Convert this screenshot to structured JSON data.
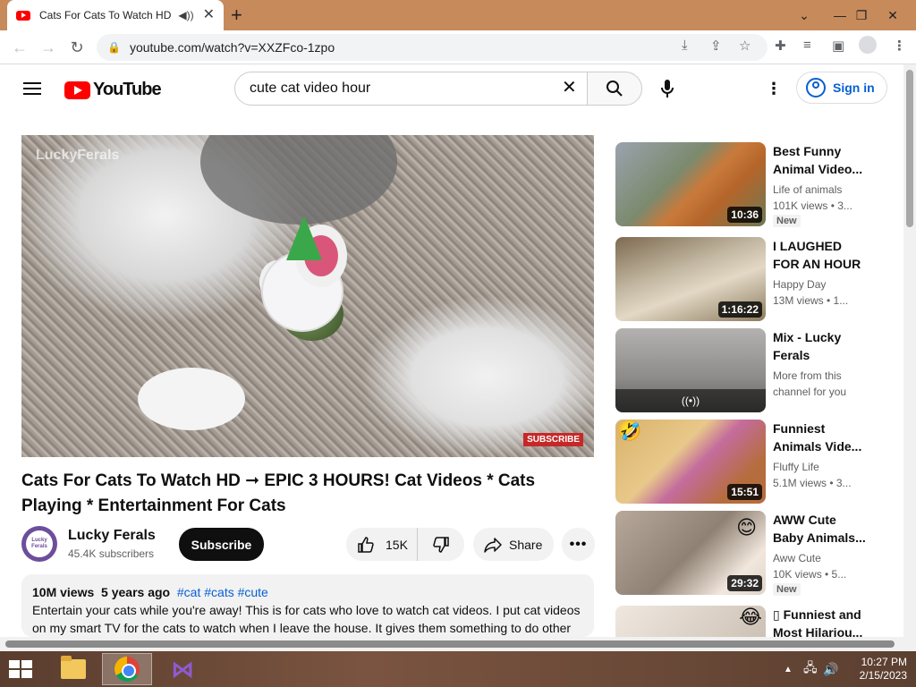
{
  "browser": {
    "tab_title": "Cats For Cats To Watch HD -",
    "new_tab": "+",
    "url": "youtube.com/watch?v=XXZFco-1zpo",
    "window_controls": {
      "dropdown": "⌄",
      "minimize": "—",
      "restore": "❐",
      "close": "✕"
    }
  },
  "header": {
    "logo_text": "YouTube",
    "search_query": "cute cat video hour",
    "signin_label": "Sign in"
  },
  "player": {
    "watermark": "LuckyFerals",
    "subscribe_badge": "SUBSCRIBE"
  },
  "video": {
    "title": "Cats For Cats To Watch HD ➞ EPIC 3 HOURS! Cat Videos * Cats Playing * Entertainment For Cats",
    "channel_name": "Lucky Ferals",
    "channel_avatar_text": "Lucky Ferals",
    "subscribers": "45.4K subscribers",
    "subscribe_label": "Subscribe",
    "likes": "15K",
    "share_label": "Share",
    "more_label": "•••",
    "views": "10M views",
    "age": "5 years ago",
    "hashtags": "#cat #cats #cute",
    "description": "Entertain your cats while you're away! This is for cats who love to watch cat videos. I put cat videos on my smart TV for the cats to watch when I leave the house. It gives them something to do other"
  },
  "recommendations": [
    {
      "title": "Best Funny Animal Video...",
      "channel": "Life of animals",
      "views": "101K views  • 3...",
      "duration": "10:36",
      "badge": "New"
    },
    {
      "title": "I LAUGHED FOR AN HOUR😹...",
      "channel": "Happy Day",
      "views": "13M views  • 1...",
      "duration": "1:16:22",
      "badge": ""
    },
    {
      "title": "Mix - Lucky Ferals",
      "channel": "More from this channel for you",
      "views": "",
      "duration": "",
      "mix_icon": "((•))",
      "badge": ""
    },
    {
      "title": "Funniest Animals Vide...",
      "channel": "Fluffy Life",
      "views": "5.1M views  • 3...",
      "duration": "15:51",
      "badge": ""
    },
    {
      "title": "AWW Cute Baby Animals...",
      "channel": "Aww Cute",
      "views": "10K views  • 5...",
      "duration": "29:32",
      "badge": "New"
    },
    {
      "title": "▯ Funniest and Most Hilariou...",
      "channel": "",
      "views": "",
      "duration": "",
      "badge": ""
    }
  ],
  "taskbar": {
    "time": "10:27 PM",
    "date": "2/15/2023",
    "apps": [
      "file-explorer",
      "google-chrome",
      "visual-studio"
    ]
  },
  "colors": {
    "youtube_red": "#ff0000",
    "link_blue": "#065fd4",
    "titlebar": "#c78a5b"
  }
}
